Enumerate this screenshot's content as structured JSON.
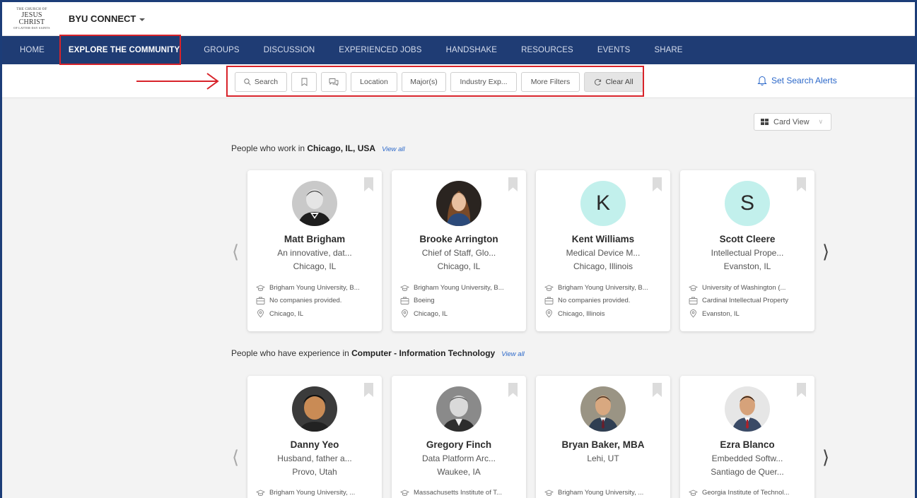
{
  "header": {
    "logo": {
      "line1": "THE CHURCH OF",
      "line2": "JESUS CHRIST",
      "line3": "OF LATTER-DAY SAINTS"
    },
    "brand": "BYU CONNECT"
  },
  "nav": {
    "items": [
      {
        "label": "HOME"
      },
      {
        "label": "EXPLORE THE COMMUNITY"
      },
      {
        "label": "GROUPS"
      },
      {
        "label": "DISCUSSION"
      },
      {
        "label": "EXPERIENCED JOBS"
      },
      {
        "label": "HANDSHAKE"
      },
      {
        "label": "RESOURCES"
      },
      {
        "label": "EVENTS"
      },
      {
        "label": "SHARE"
      }
    ],
    "active": "EXPLORE THE COMMUNITY"
  },
  "filters": {
    "search": "Search",
    "location": "Location",
    "majors": "Major(s)",
    "industry": "Industry Exp...",
    "more": "More Filters",
    "clear": "Clear All",
    "alerts": "Set Search Alerts"
  },
  "view": {
    "label": "Card View"
  },
  "sections": [
    {
      "prefix": "People who work in ",
      "highlight": "Chicago, IL, USA",
      "view_all": "View all",
      "cards": [
        {
          "name": "Matt Brigham",
          "headline": "An innovative, dat...",
          "location": "Chicago, IL",
          "school": "Brigham Young University, B...",
          "company": "No companies provided.",
          "place": "Chicago, IL"
        },
        {
          "name": "Brooke Arrington",
          "headline": "Chief of Staff, Glo...",
          "location": "Chicago, IL",
          "school": "Brigham Young University, B...",
          "company": "Boeing",
          "place": "Chicago, IL"
        },
        {
          "name": "Kent Williams",
          "headline": "Medical Device M...",
          "location": "Chicago, Illinois",
          "school": "Brigham Young University, B...",
          "company": "No companies provided.",
          "place": "Chicago, Illinois",
          "initial": "K"
        },
        {
          "name": "Scott Cleere",
          "headline": "Intellectual Prope...",
          "location": "Evanston, IL",
          "school": "University of Washington (...",
          "company": "Cardinal Intellectual Property",
          "place": "Evanston, IL",
          "initial": "S"
        }
      ]
    },
    {
      "prefix": "People who have experience in ",
      "highlight": "Computer - Information Technology",
      "view_all": "View all",
      "cards": [
        {
          "name": "Danny Yeo",
          "headline": "Husband, father a...",
          "location": "Provo, Utah",
          "school": "Brigham Young University, ..."
        },
        {
          "name": "Gregory Finch",
          "headline": "Data Platform Arc...",
          "location": "Waukee, IA",
          "school": "Massachusetts Institute of T..."
        },
        {
          "name": "Bryan Baker, MBA",
          "headline": "Lehi, UT",
          "location": "",
          "school": "Brigham Young University, ..."
        },
        {
          "name": "Ezra Blanco",
          "headline": "Embedded Softw...",
          "location": "Santiago de Quer...",
          "school": "Georgia Institute of Technol..."
        }
      ]
    }
  ],
  "colors": {
    "nav_bg": "#1f3c74",
    "accent": "#2a67c9",
    "highlight_box": "#d8232a",
    "avatar_letter_bg": "#c2f0ec"
  }
}
